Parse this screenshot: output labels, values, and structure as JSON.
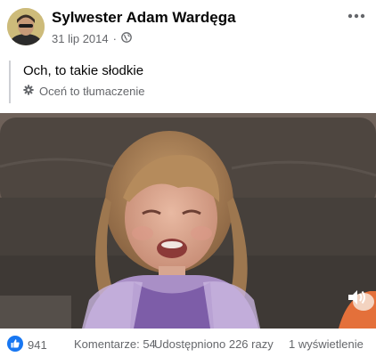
{
  "post": {
    "author": "Sylwester Adam Wardęga",
    "date": "31 lip 2014",
    "privacy_icon": "globe-icon",
    "text": "Och, to takie słodkie",
    "rate_translation": "Oceń to tłumaczenie",
    "menu_icon": "more-options-icon"
  },
  "video": {
    "sound_icon": "sound-icon"
  },
  "stats": {
    "likes": "941",
    "comments": "Komentarze: 54",
    "shares": "Udostępniono 226 razy",
    "views": "1 wyświetlenie"
  },
  "colors": {
    "like_blue": "#1877f2",
    "secondary_text": "#65676b"
  }
}
